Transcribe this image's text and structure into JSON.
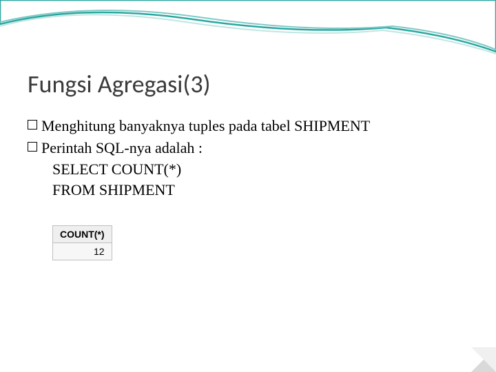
{
  "slide": {
    "title": "Fungsi Agregasi(3)",
    "bullets": [
      "Menghitung banyaknya tuples pada tabel SHIPMENT",
      "Perintah SQL-nya adalah :"
    ],
    "sql": {
      "line1": "SELECT COUNT(*)",
      "line2": "FROM SHIPMENT"
    },
    "result": {
      "header": "COUNT(*)",
      "value": "12"
    }
  }
}
